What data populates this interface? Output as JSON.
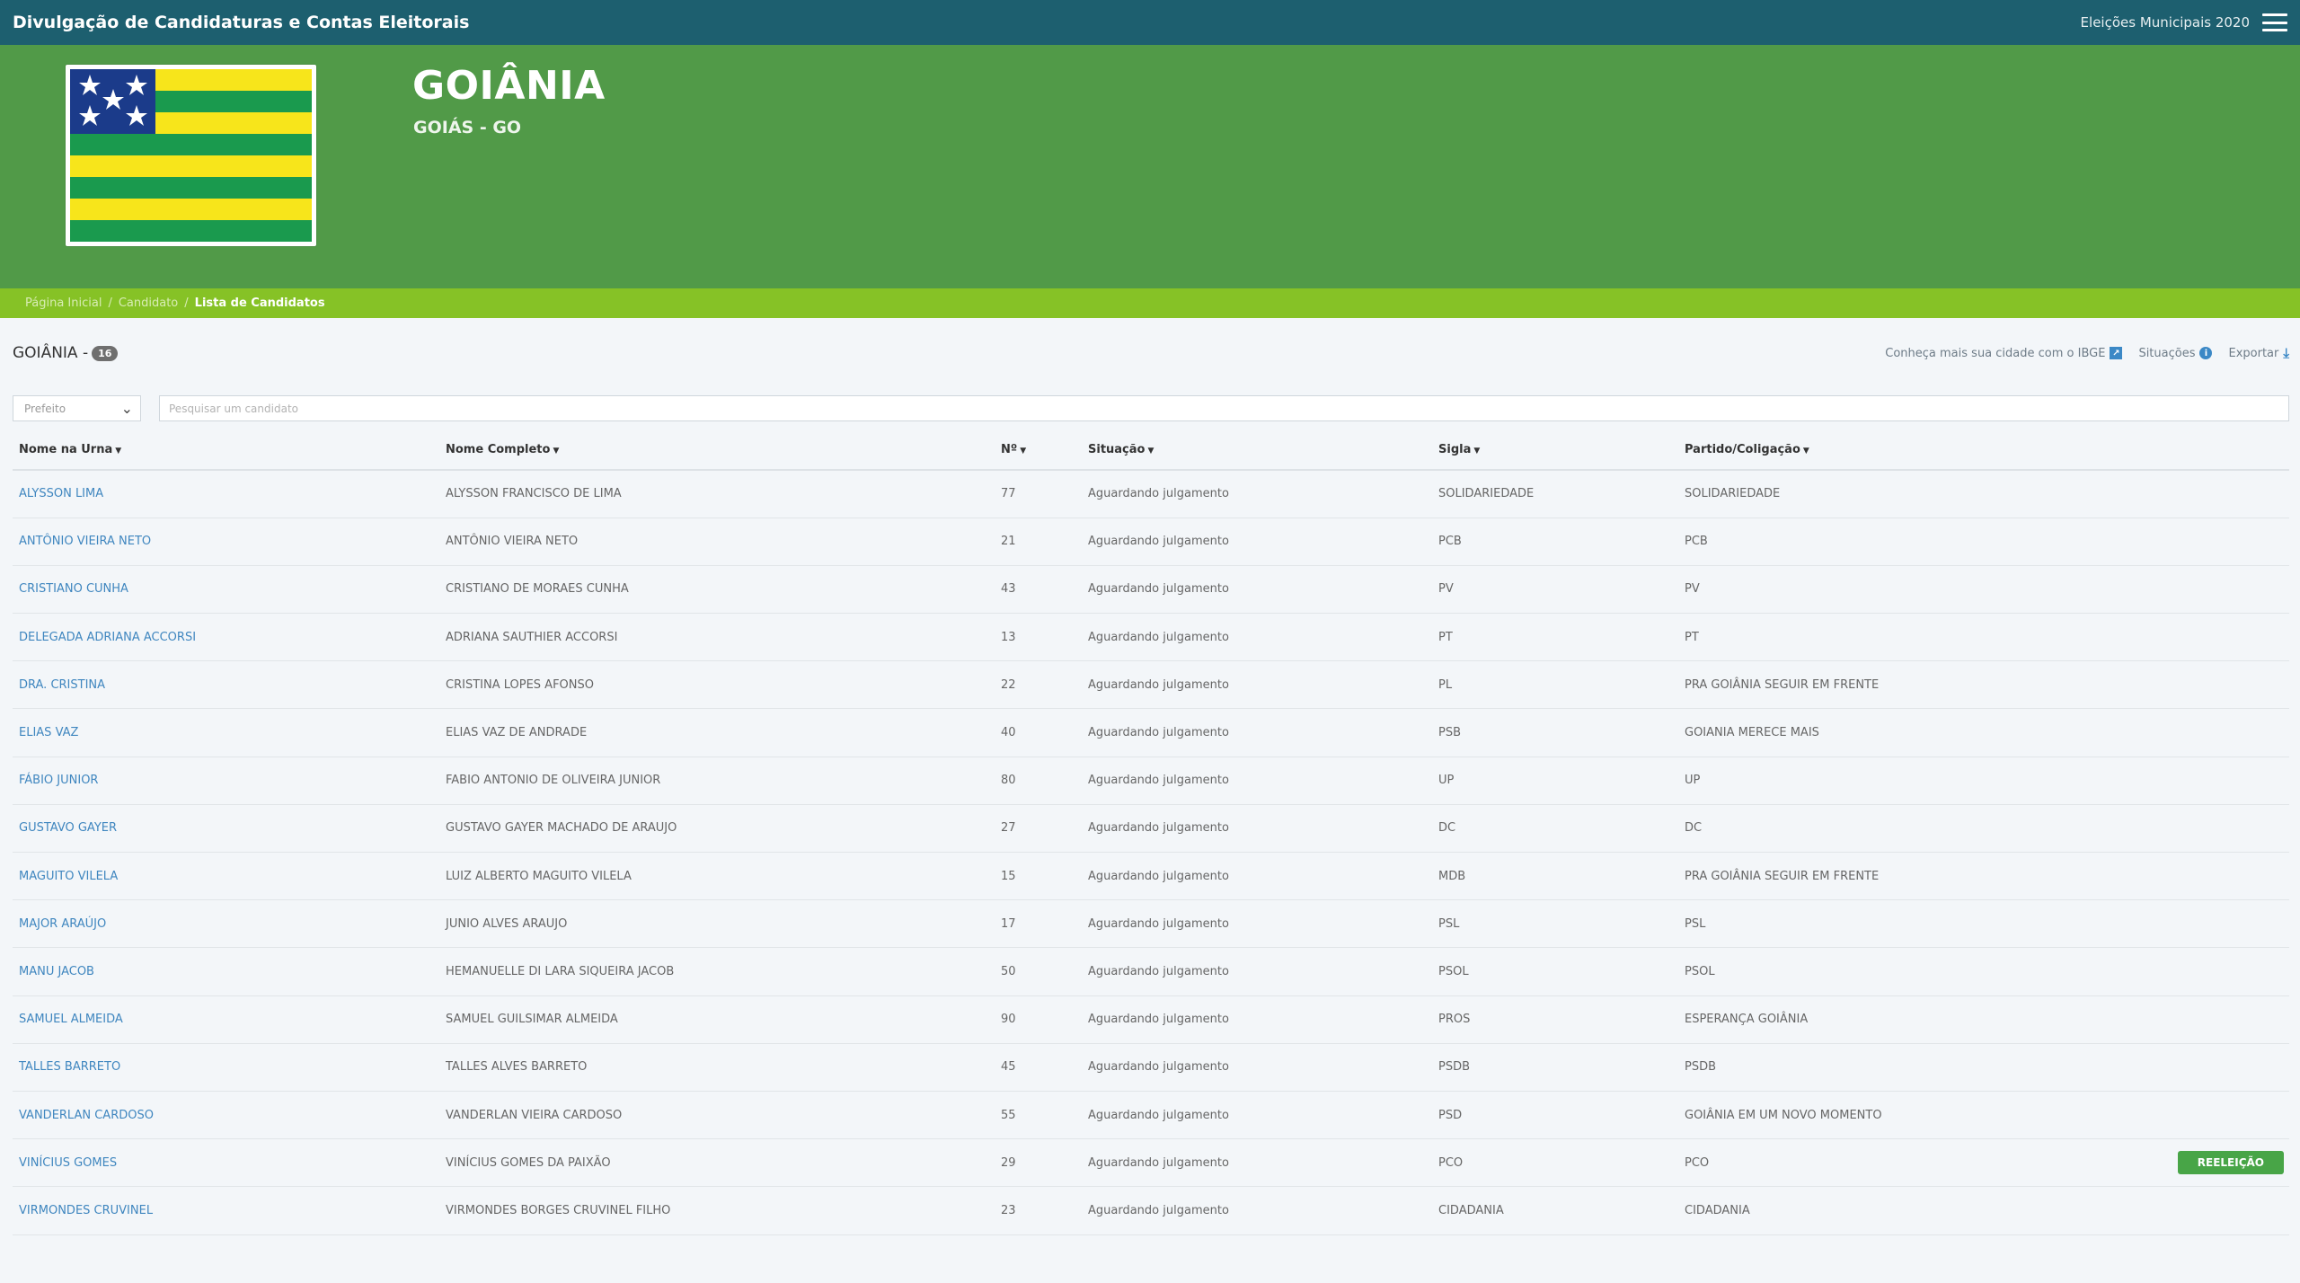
{
  "topbar": {
    "title": "Divulgação de Candidaturas e Contas Eleitorais",
    "election": "Eleições Municipais 2020"
  },
  "hero": {
    "city": "GOIÂNIA",
    "state": "GOIÁS - GO"
  },
  "breadcrumb": {
    "home": "Página Inicial",
    "candidate": "Candidato",
    "current": "Lista de Candidatos",
    "separator": "/"
  },
  "list": {
    "title": "GOIÂNIA -",
    "count": "16",
    "ibge_link": "Conheça mais sua cidade com o IBGE",
    "situations_link": "Situações",
    "export_link": "Exportar"
  },
  "filters": {
    "office_selected": "Prefeito",
    "search_placeholder": "Pesquisar um candidato"
  },
  "table": {
    "headers": [
      "Nome na Urna",
      "Nome Completo",
      "Nº",
      "Situação",
      "Sigla",
      "Partido/Coligação"
    ],
    "rows": [
      {
        "urn": "ALYSSON LIMA",
        "full": "ALYSSON FRANCISCO DE LIMA",
        "num": "77",
        "status": "Aguardando julgamento",
        "abbr": "SOLIDARIEDADE",
        "party": "SOLIDARIEDADE",
        "badge": ""
      },
      {
        "urn": "ANTÔNIO VIEIRA NETO",
        "full": "ANTÔNIO VIEIRA NETO",
        "num": "21",
        "status": "Aguardando julgamento",
        "abbr": "PCB",
        "party": "PCB",
        "badge": ""
      },
      {
        "urn": "CRISTIANO CUNHA",
        "full": "CRISTIANO DE MORAES CUNHA",
        "num": "43",
        "status": "Aguardando julgamento",
        "abbr": "PV",
        "party": "PV",
        "badge": ""
      },
      {
        "urn": "DELEGADA ADRIANA ACCORSI",
        "full": "ADRIANA SAUTHIER ACCORSI",
        "num": "13",
        "status": "Aguardando julgamento",
        "abbr": "PT",
        "party": "PT",
        "badge": ""
      },
      {
        "urn": "DRA. CRISTINA",
        "full": "CRISTINA LOPES AFONSO",
        "num": "22",
        "status": "Aguardando julgamento",
        "abbr": "PL",
        "party": "PRA GOIÂNIA SEGUIR EM FRENTE",
        "badge": ""
      },
      {
        "urn": "ELIAS VAZ",
        "full": "ELIAS VAZ DE ANDRADE",
        "num": "40",
        "status": "Aguardando julgamento",
        "abbr": "PSB",
        "party": "GOIANIA MERECE MAIS",
        "badge": ""
      },
      {
        "urn": "FÁBIO JUNIOR",
        "full": "FABIO ANTONIO DE OLIVEIRA JUNIOR",
        "num": "80",
        "status": "Aguardando julgamento",
        "abbr": "UP",
        "party": "UP",
        "badge": ""
      },
      {
        "urn": "GUSTAVO GAYER",
        "full": "GUSTAVO GAYER MACHADO DE ARAUJO",
        "num": "27",
        "status": "Aguardando julgamento",
        "abbr": "DC",
        "party": "DC",
        "badge": ""
      },
      {
        "urn": "MAGUITO VILELA",
        "full": "LUIZ ALBERTO MAGUITO VILELA",
        "num": "15",
        "status": "Aguardando julgamento",
        "abbr": "MDB",
        "party": "PRA GOIÂNIA SEGUIR EM FRENTE",
        "badge": ""
      },
      {
        "urn": "MAJOR ARAÚJO",
        "full": "JUNIO ALVES ARAUJO",
        "num": "17",
        "status": "Aguardando julgamento",
        "abbr": "PSL",
        "party": "PSL",
        "badge": ""
      },
      {
        "urn": "MANU JACOB",
        "full": "HEMANUELLE DI LARA SIQUEIRA JACOB",
        "num": "50",
        "status": "Aguardando julgamento",
        "abbr": "PSOL",
        "party": "PSOL",
        "badge": ""
      },
      {
        "urn": "SAMUEL ALMEIDA",
        "full": "SAMUEL GUILSIMAR ALMEIDA",
        "num": "90",
        "status": "Aguardando julgamento",
        "abbr": "PROS",
        "party": "ESPERANÇA GOIÂNIA",
        "badge": ""
      },
      {
        "urn": "TALLES BARRETO",
        "full": "TALLES ALVES BARRETO",
        "num": "45",
        "status": "Aguardando julgamento",
        "abbr": "PSDB",
        "party": "PSDB",
        "badge": ""
      },
      {
        "urn": "VANDERLAN CARDOSO",
        "full": "VANDERLAN VIEIRA CARDOSO",
        "num": "55",
        "status": "Aguardando julgamento",
        "abbr": "PSD",
        "party": "GOIÂNIA EM UM NOVO MOMENTO",
        "badge": ""
      },
      {
        "urn": "VINÍCIUS GOMES",
        "full": "VINÍCIUS GOMES DA PAIXÃO",
        "num": "29",
        "status": "Aguardando julgamento",
        "abbr": "PCO",
        "party": "PCO",
        "badge": "REELEIÇÃO"
      },
      {
        "urn": "VIRMONDES CRUVINEL",
        "full": "VIRMONDES BORGES CRUVINEL FILHO",
        "num": "23",
        "status": "Aguardando julgamento",
        "abbr": "CIDADANIA",
        "party": "CIDADANIA",
        "badge": ""
      }
    ]
  },
  "colors": {
    "topbar": "#1d5f6f",
    "hero": "#519a48",
    "breadcrumb": "#86c226",
    "link": "#3f86bf",
    "badge": "#48a547"
  },
  "icons": {
    "menu": "hamburger-icon",
    "ibge": "external-link-icon",
    "situations": "info-icon",
    "export": "download-icon",
    "sort": "caret-down-icon",
    "select": "chevron-down-icon"
  }
}
